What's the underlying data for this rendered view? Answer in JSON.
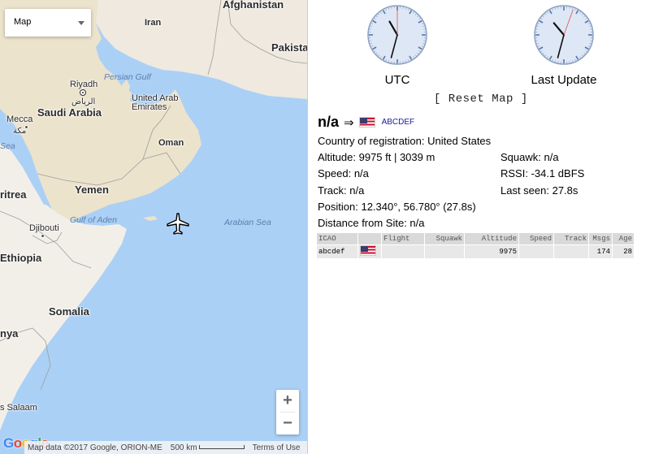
{
  "map": {
    "type_control": {
      "label": "Map"
    },
    "labels": {
      "afghanistan": "Afghanistan",
      "iran": "Iran",
      "pakistan": "Pakista",
      "riyadh": "Riyadh",
      "riyadh_ar": "الرياض",
      "persian_gulf": "Persian Gulf",
      "saudi_arabia": "Saudi Arabia",
      "uae": "United Arab\nEmirates",
      "mecca": "Mecca",
      "mecca_ar": "مكة",
      "red_sea": "Sea",
      "oman": "Oman",
      "yemen": "Yemen",
      "eritrea": "ritrea",
      "gulf_of_aden": "Gulf of Aden",
      "arabian_sea": "Arabian Sea",
      "djibouti": "Djibouti",
      "ethiopia": "Ethiopia",
      "somalia": "Somalia",
      "kenya": "nya",
      "dar_es_salaam": "s Salaam"
    },
    "zoom_in": "+",
    "zoom_out": "−",
    "google_logo": "Google",
    "attribution": "Map data ©2017 Google, ORION-ME",
    "scale": "500 km",
    "terms": "Terms of Use"
  },
  "clocks": [
    {
      "label": "UTC",
      "hour_angle": 330,
      "minute_angle": 195,
      "second_angle": 0
    },
    {
      "label": "Last Update",
      "hour_angle": 320,
      "minute_angle": 195,
      "second_angle": 20
    }
  ],
  "reset_map": "[ Reset Map ]",
  "selected": {
    "callsign": "n/a",
    "arrow": "⇒",
    "hex": "ABCDEF",
    "country": "Country of registration: United States",
    "altitude": "Altitude: 9975 ft | 3039 m",
    "squawk": "Squawk: n/a",
    "speed": "Speed: n/a",
    "rssi": "RSSI: -34.1 dBFS",
    "track": "Track: n/a",
    "last_seen": "Last seen: 27.8s",
    "position": "Position: 12.340°, 56.780° (27.8s)",
    "distance": "Distance from Site: n/a"
  },
  "table": {
    "headers": [
      "ICAO",
      "",
      "Flight",
      "Squawk",
      "Altitude",
      "Speed",
      "Track",
      "Msgs",
      "Age"
    ],
    "rows": [
      {
        "icao": "abcdef",
        "flight": "",
        "squawk": "",
        "altitude": "9975",
        "speed": "",
        "track": "",
        "msgs": "174",
        "age": "28"
      }
    ]
  },
  "colors": {
    "water": "#abd0f5",
    "land": "#f2efe9",
    "desert": "#ece3cc",
    "clock_face": "#dde7f5",
    "second_hand": "#e05050"
  }
}
